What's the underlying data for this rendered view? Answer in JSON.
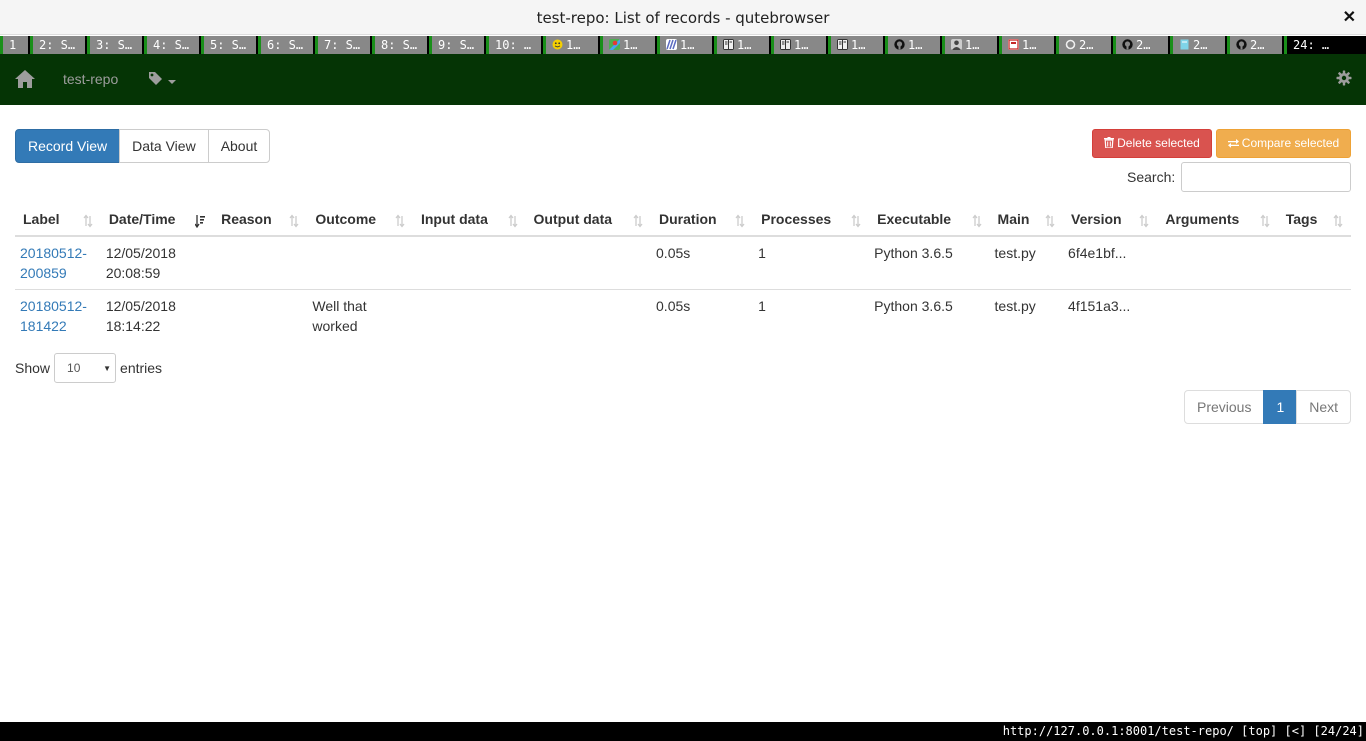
{
  "window": {
    "title": "test-repo: List of records - qutebrowser",
    "close_glyph": "✕"
  },
  "tabs": [
    {
      "label": "1",
      "icon": "none",
      "width": 28
    },
    {
      "label": "2: S…",
      "icon": "none",
      "width": 55
    },
    {
      "label": "3: S…",
      "icon": "none",
      "width": 55
    },
    {
      "label": "4: S…",
      "icon": "none",
      "width": 55
    },
    {
      "label": "5: S…",
      "icon": "none",
      "width": 55
    },
    {
      "label": "6: S…",
      "icon": "none",
      "width": 55
    },
    {
      "label": "7: S…",
      "icon": "none",
      "width": 55
    },
    {
      "label": "8: S…",
      "icon": "none",
      "width": 55
    },
    {
      "label": "9: S…",
      "icon": "none",
      "width": 55
    },
    {
      "label": "10: …",
      "icon": "none",
      "width": 55
    },
    {
      "label": "1…",
      "icon": "smiley-icon",
      "width": 55
    },
    {
      "label": "1…",
      "icon": "maps-icon",
      "width": 55
    },
    {
      "label": "1…",
      "icon": "feed-icon",
      "width": 55
    },
    {
      "label": "1…",
      "icon": "book-icon",
      "width": 55
    },
    {
      "label": "1…",
      "icon": "book-icon",
      "width": 55
    },
    {
      "label": "1…",
      "icon": "book-icon",
      "width": 55
    },
    {
      "label": "1…",
      "icon": "github-icon",
      "width": 55
    },
    {
      "label": "1…",
      "icon": "user-icon",
      "width": 55
    },
    {
      "label": "1…",
      "icon": "flag-icon",
      "width": 55
    },
    {
      "label": "2…",
      "icon": "circle-icon",
      "width": 55
    },
    {
      "label": "2…",
      "icon": "github-icon",
      "width": 55
    },
    {
      "label": "2…",
      "icon": "page-icon",
      "width": 55
    },
    {
      "label": "2…",
      "icon": "github-icon",
      "width": 55
    },
    {
      "label": "24: …",
      "icon": "none",
      "width": 55,
      "active": true
    }
  ],
  "navbar": {
    "brand": "test-repo",
    "bg_color": "#053405"
  },
  "view_buttons": {
    "record_view": "Record View",
    "data_view": "Data View",
    "about": "About"
  },
  "actions": {
    "delete_selected": "Delete selected",
    "compare_selected": "Compare selected"
  },
  "search": {
    "label": "Search:",
    "value": ""
  },
  "table": {
    "columns": [
      "Label",
      "Date/Time",
      "Reason",
      "Outcome",
      "Input data",
      "Output data",
      "Duration",
      "Processes",
      "Executable",
      "Main",
      "Version",
      "Arguments",
      "Tags"
    ],
    "rows": [
      {
        "label": "20180512-200859",
        "label_line1": "20180512-",
        "label_line2": "200859",
        "date": "12/05/2018",
        "time": "20:08:59",
        "reason": "",
        "outcome_line1": "",
        "outcome_line2": "",
        "input_data": "",
        "output_data": "",
        "duration": "0.05s",
        "processes": "1",
        "executable": "Python 3.6.5",
        "main": "test.py",
        "version": "6f4e1bf...",
        "arguments": "",
        "tags": ""
      },
      {
        "label": "20180512-181422",
        "label_line1": "20180512-",
        "label_line2": "181422",
        "date": "12/05/2018",
        "time": "18:14:22",
        "reason": "",
        "outcome_line1": "Well that",
        "outcome_line2": "worked",
        "input_data": "",
        "output_data": "",
        "duration": "0.05s",
        "processes": "1",
        "executable": "Python 3.6.5",
        "main": "test.py",
        "version": "4f151a3...",
        "arguments": "",
        "tags": ""
      }
    ]
  },
  "length": {
    "show_label": "Show",
    "selected": "10",
    "entries_label": "entries"
  },
  "pagination": {
    "previous": "Previous",
    "current": "1",
    "next": "Next"
  },
  "statusbar": {
    "url": "http://127.0.0.1:8001/test-repo/",
    "position": "[top]",
    "history": "[<]",
    "tab_index": "[24/24]"
  },
  "colors": {
    "primary": "#337ab7",
    "danger": "#d9534f",
    "warning": "#f0ad4e",
    "tab_indicator": "#1a8f1a"
  }
}
